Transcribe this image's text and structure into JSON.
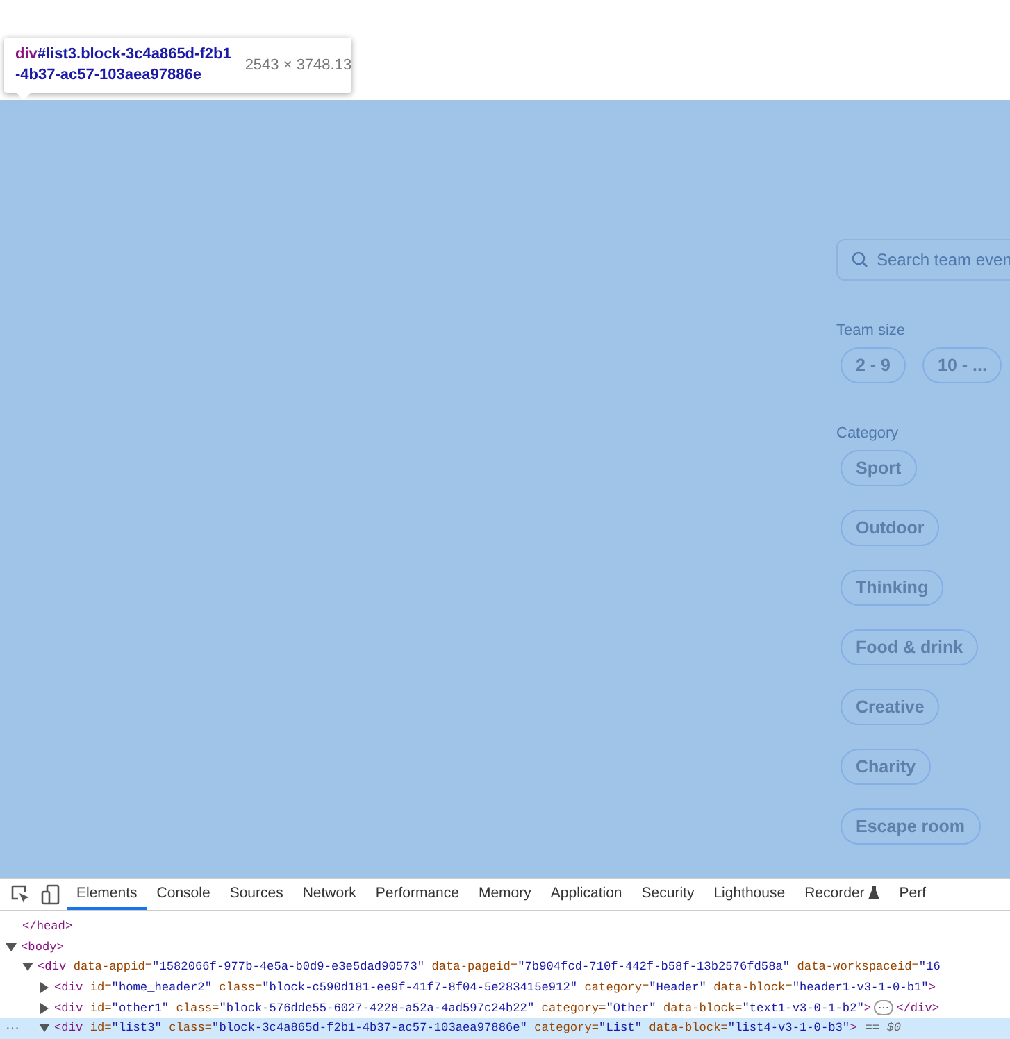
{
  "tooltip": {
    "tag": "div",
    "selector": "#list3.block-3c4a865d-f2b1",
    "selector_cont": "-4b37-ac57-103aea97886e",
    "size": "2543 × 3748.13"
  },
  "page": {
    "search": {
      "placeholder": "Search team even"
    },
    "filters": [
      {
        "label": "Team size",
        "chips": [
          "2 - 9",
          "10 - ..."
        ]
      },
      {
        "label": "Category",
        "chips": [
          "Sport",
          "Outdoor",
          "Thinking",
          "Food & drink",
          "Creative",
          "Charity",
          "Escape room"
        ]
      }
    ]
  },
  "devtools": {
    "tabs": [
      {
        "label": "Elements",
        "selected": true
      },
      {
        "label": "Console",
        "selected": false
      },
      {
        "label": "Sources",
        "selected": false
      },
      {
        "label": "Network",
        "selected": false
      },
      {
        "label": "Performance",
        "selected": false
      },
      {
        "label": "Memory",
        "selected": false
      },
      {
        "label": "Application",
        "selected": false
      },
      {
        "label": "Security",
        "selected": false
      },
      {
        "label": "Lighthouse",
        "selected": false
      },
      {
        "label": "Recorder",
        "selected": false,
        "flask": true
      },
      {
        "label": "Perf",
        "selected": false
      }
    ],
    "nodes": [
      {
        "kind": "closing",
        "selected": false,
        "open": "</head",
        "close": ">"
      },
      {
        "kind": "element",
        "expanded": true,
        "selected": false,
        "open": "<body",
        "close": ">",
        "children": [
          {
            "kind": "element",
            "expanded": true,
            "selected": false,
            "open": "<div",
            "attrs": [
              {
                "name": "data-appid=",
                "value": "\"1582066f-977b-4e5a-b0d9-e3e5dad90573\""
              },
              {
                "name": "data-pageid=",
                "value": "\"7b904fcd-710f-442f-b58f-13b2576fd58a\""
              },
              {
                "name": "data-workspaceid=",
                "value": "\"16"
              }
            ],
            "children": [
              {
                "kind": "element",
                "expanded": false,
                "selected": false,
                "open": "<div",
                "attrs": [
                  {
                    "name": "id=",
                    "value": "\"home_header2\""
                  },
                  {
                    "name": "class=",
                    "value": "\"block-c590d181-ee9f-41f7-8f04-5e283415e912\""
                  },
                  {
                    "name": "category=",
                    "value": "\"Header\""
                  },
                  {
                    "name": "data-block=",
                    "value": "\"header1-v3-1-0-b1\""
                  }
                ],
                "close": ">"
              },
              {
                "kind": "element",
                "expanded": false,
                "selected": false,
                "open": "<div",
                "attrs": [
                  {
                    "name": "id=",
                    "value": "\"other1\""
                  },
                  {
                    "name": "class=",
                    "value": "\"block-576dde55-6027-4228-a52a-4ad597c24b22\""
                  },
                  {
                    "name": "category=",
                    "value": "\"Other\""
                  },
                  {
                    "name": "data-block=",
                    "value": "\"text1-v3-0-1-b2\""
                  }
                ],
                "close": ">",
                "ellipsis": "⋯",
                "end": "</div>"
              },
              {
                "kind": "element",
                "expanded": true,
                "selected": true,
                "open": "<div",
                "attrs": [
                  {
                    "name": "id=",
                    "value": "\"list3\""
                  },
                  {
                    "name": "class=",
                    "value": "\"block-3c4a865d-f2b1-4b37-ac57-103aea97886e\""
                  },
                  {
                    "name": "category=",
                    "value": "\"List\""
                  },
                  {
                    "name": "data-block=",
                    "value": "\"list4-v3-1-0-b3\""
                  }
                ],
                "close": ">",
                "ref": "== $0",
                "dots": "···"
              }
            ]
          }
        ]
      }
    ]
  }
}
